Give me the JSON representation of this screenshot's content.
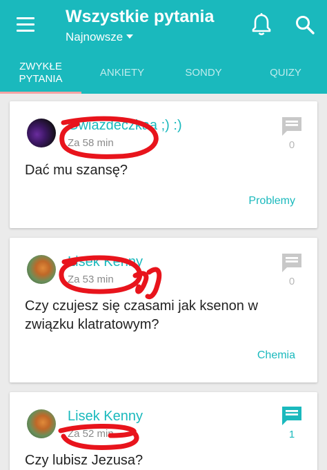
{
  "header": {
    "title": "Wszystkie pytania",
    "subtitle": "Najnowsze",
    "icons": [
      "menu-icon",
      "bell-icon",
      "search-icon"
    ]
  },
  "tabs": [
    {
      "label": "ZWYKŁE\nPYTANIA",
      "active": true
    },
    {
      "label": "ANKIETY",
      "active": false
    },
    {
      "label": "SONDY",
      "active": false
    },
    {
      "label": "QUIZY",
      "active": false
    }
  ],
  "posts": [
    {
      "author": "Gwiazdeczkaa ;) :)",
      "time": "Za 58 min",
      "question": "Dać mu szansę?",
      "category": "Problemy",
      "answers": "0",
      "has_answers": false
    },
    {
      "author": "Lisek Kenny",
      "time": "Za 53 min",
      "question": "Czy czujesz się czasami jak ksenon w związku klatratowym?",
      "category": "Chemia",
      "answers": "0",
      "has_answers": false
    },
    {
      "author": "Lisek Kenny",
      "time": "Za 52 min",
      "question": "Czy lubisz Jezusa?",
      "category": "",
      "answers": "1",
      "has_answers": true
    }
  ],
  "colors": {
    "primary": "#1ab9bd",
    "annotation": "#e8141c",
    "tab_indicator": "#f4a3a3",
    "inactive_icon": "#c8c8c8"
  }
}
